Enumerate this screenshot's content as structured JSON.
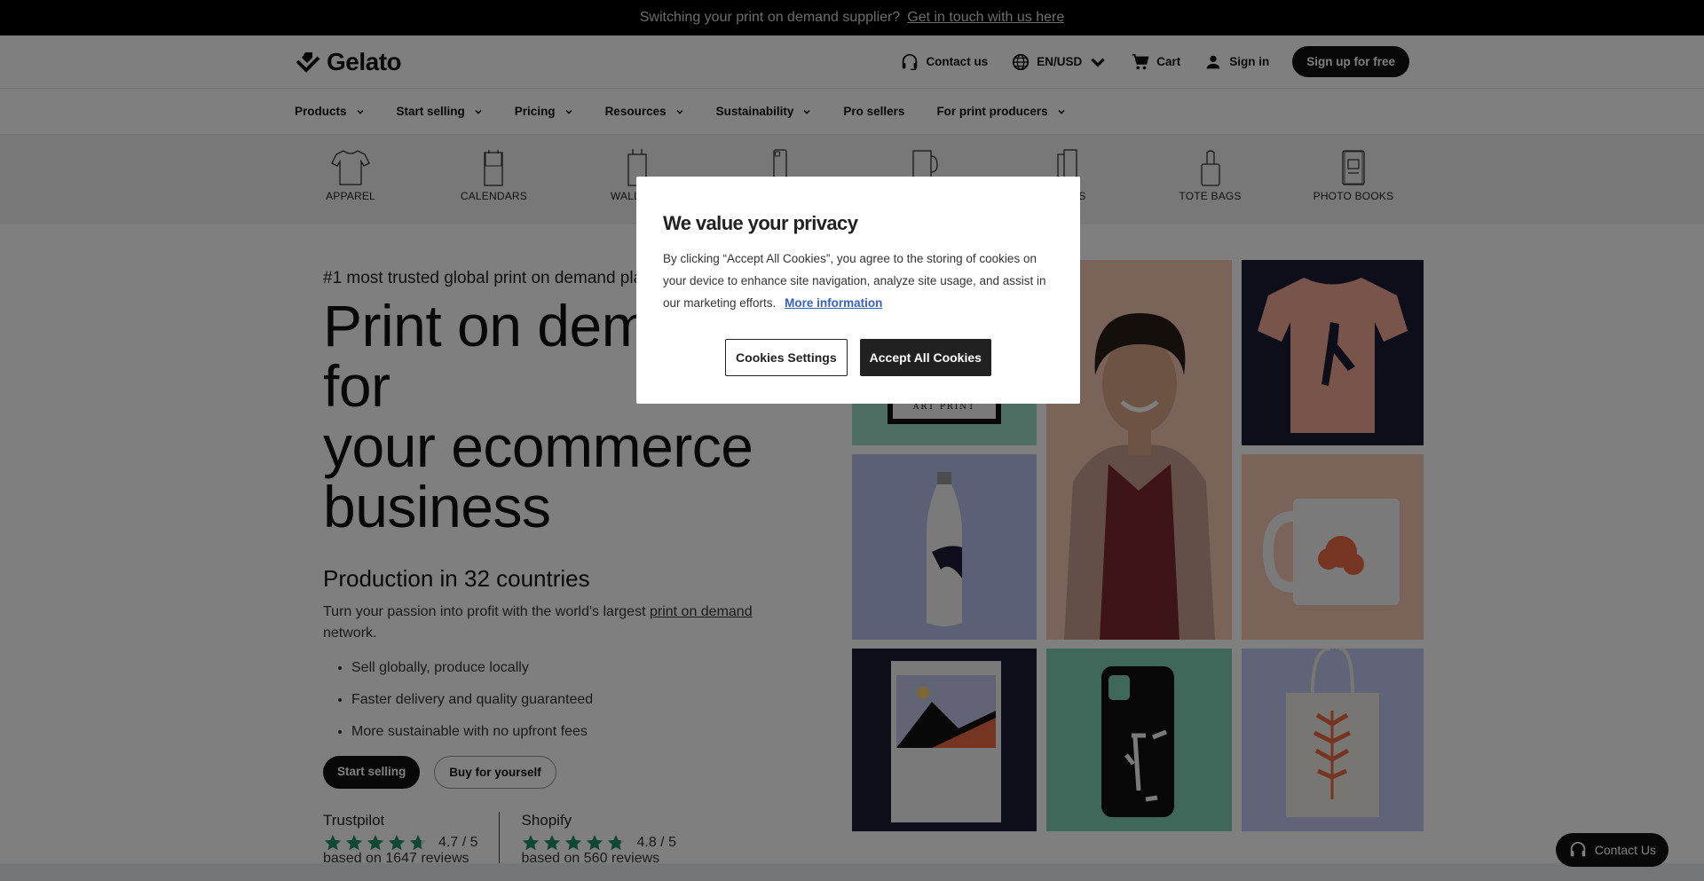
{
  "banner": {
    "text": "Switching your print on demand supplier?",
    "link": "Get in touch with us here"
  },
  "header": {
    "logo": "Gelato",
    "contact": "Contact us",
    "locale": "EN/USD",
    "cart": "Cart",
    "signin": "Sign in",
    "signup": "Sign up for free"
  },
  "nav": [
    {
      "label": "Products",
      "dropdown": true
    },
    {
      "label": "Start selling",
      "dropdown": true
    },
    {
      "label": "Pricing",
      "dropdown": true
    },
    {
      "label": "Resources",
      "dropdown": true
    },
    {
      "label": "Sustainability",
      "dropdown": true
    },
    {
      "label": "Pro sellers",
      "dropdown": false
    },
    {
      "label": "For print producers",
      "dropdown": true
    }
  ],
  "categories": [
    "APPAREL",
    "CALENDARS",
    "WALL ART",
    "PHONE CASES",
    "MUGS",
    "CARDS",
    "TOTE BAGS",
    "PHOTO BOOKS"
  ],
  "hero": {
    "eyebrow": "#1 most trusted global print on demand platform",
    "title_lines": [
      "Print on demand for",
      "your ecommerce",
      "business"
    ],
    "subtitle": "Production in 32 countries",
    "lead_pre": "Turn your passion into profit with the world's largest",
    "lead_link": "print on demand",
    "lead_post": "network.",
    "bullets": [
      "Sell globally, produce locally",
      "Faster delivery and quality guaranteed",
      "More sustainable with no upfront fees"
    ],
    "cta_primary": "Start selling",
    "cta_secondary": "Buy for yourself"
  },
  "ratings": [
    {
      "source": "Trustpilot",
      "score": "4.7 / 5",
      "stars": 4.7,
      "based": "based on 1647 reviews"
    },
    {
      "source": "Shopify",
      "score": "4.8 / 5",
      "stars": 4.8,
      "based": "based on 560 reviews"
    }
  ],
  "gallery": {
    "art_print_label": "ART PRINT"
  },
  "colors": {
    "star": "#1f8f66",
    "accent_link": "#3860be"
  },
  "fab": {
    "label": "Contact Us"
  },
  "cookie_modal": {
    "title": "We value your privacy",
    "body": "By clicking “Accept All Cookies”, you agree to the storing of cookies on your device to enhance site navigation, analyze site usage, and assist in our marketing efforts.",
    "more_info": "More information",
    "settings_button": "Cookies Settings",
    "accept_button": "Accept All Cookies"
  }
}
